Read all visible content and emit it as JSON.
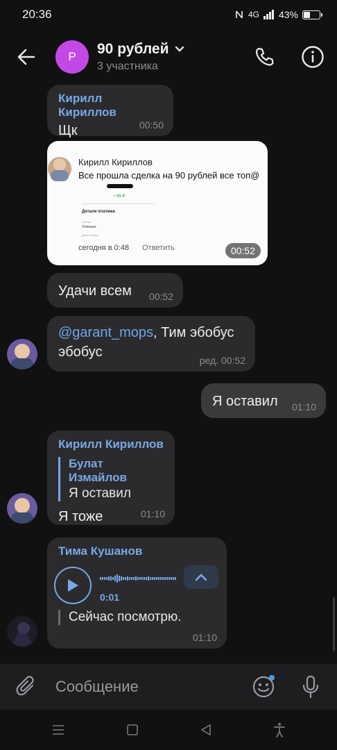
{
  "status_bar": {
    "time": "20:36",
    "battery": "43%",
    "network": "4G",
    "battery_level": 0.43
  },
  "header": {
    "title": "90 рублей",
    "subtitle": "3 участника",
    "avatar_letter": "Р",
    "avatar_color": "#c249e6"
  },
  "messages": [
    {
      "sender": "Кирилл Кириллов",
      "text": "Щк",
      "time": "00:50"
    },
    {
      "type": "photo",
      "time": "00:52",
      "screenshot": {
        "author": "Кирилл Кириллов",
        "text": "Все прошла сделка на 90 рублей все топ@",
        "amount": "+ 89 ₽",
        "details_title": "Детали платежа",
        "status_label": "Статус",
        "status_value": "Успешно",
        "date_label": "Дата оплаты",
        "footer_time": "сегодня в 0:48",
        "reply": "Ответить"
      }
    },
    {
      "text": "Удачи всем",
      "time": "00:52"
    },
    {
      "mention": "@garant_mops",
      "text": ", Тим эбобус эбобус",
      "time": "ред. 00:52"
    },
    {
      "text": "Я оставил",
      "time": "01:10",
      "own": true
    },
    {
      "sender": "Кирилл Кириллов",
      "quote_name": "Булат Измайлов",
      "quote_text": "Я оставил",
      "text": "Я тоже",
      "time": "01:10"
    },
    {
      "sender": "Тима Кушанов",
      "voice_duration": "0:01",
      "caption": "Сейчас посмотрю.",
      "time": "01:10"
    }
  ],
  "composer": {
    "placeholder": "Сообщение"
  },
  "colors": {
    "background": "#111112",
    "bubble": "#2b2b2e",
    "own_bubble": "#3a3a3d",
    "accent": "#78a9e6"
  }
}
